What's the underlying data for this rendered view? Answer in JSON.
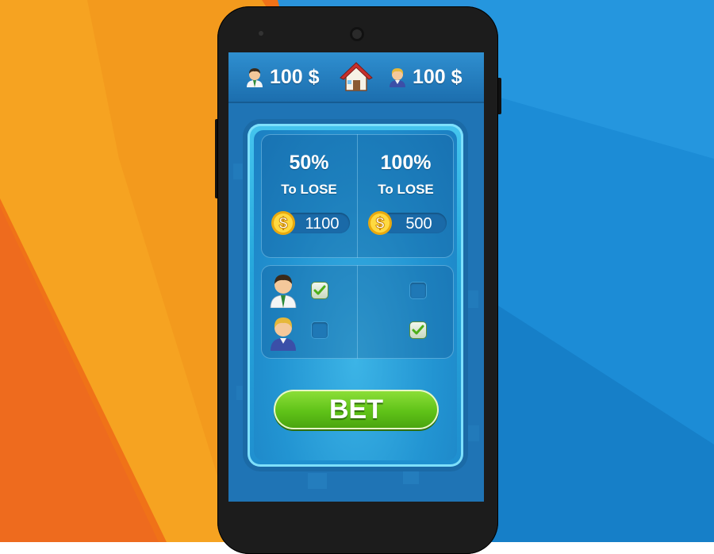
{
  "topbar": {
    "player1_money": "100 $",
    "player2_money": "100 $",
    "player1_icon": "businessman-avatar-icon",
    "player2_icon": "blonde-player-avatar-icon",
    "home_icon": "house-icon"
  },
  "bet_options": [
    {
      "percent": "50%",
      "label": "To LOSE",
      "amount": "1100",
      "player1_checked": true,
      "player2_checked": false
    },
    {
      "percent": "100%",
      "label": "To LOSE",
      "amount": "500",
      "player1_checked": false,
      "player2_checked": true
    }
  ],
  "bet_button": {
    "label": "BET"
  },
  "colors": {
    "accent_green": "#5fc218",
    "screen_blue": "#1f76b8",
    "panel_cyan": "#2aa9dd",
    "bg_orange": "#f07a1c",
    "bg_blue": "#1f9ae0"
  }
}
